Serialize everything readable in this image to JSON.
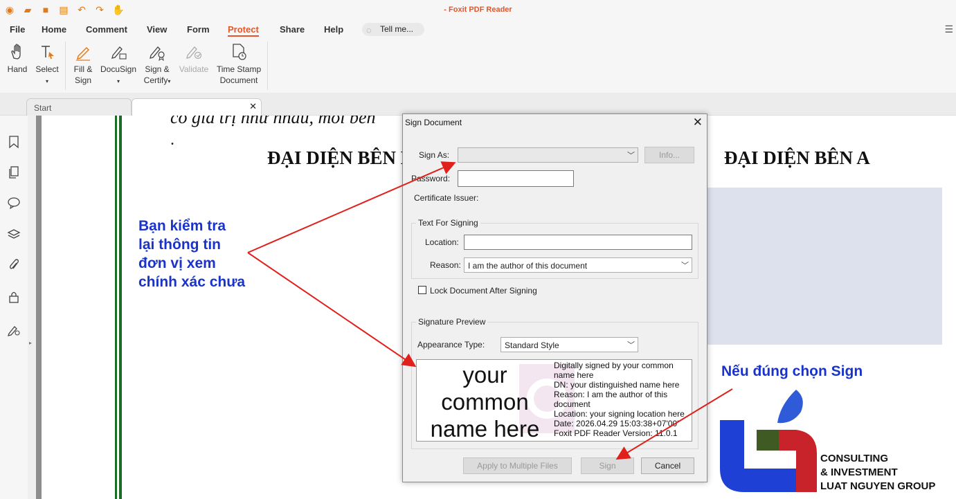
{
  "app": {
    "title": "- Foxit PDF Reader"
  },
  "menu": {
    "items": [
      "File",
      "Home",
      "Comment",
      "View",
      "Form",
      "Protect",
      "Share",
      "Help"
    ],
    "active": "Protect",
    "tell_me_placeholder": "Tell me..."
  },
  "ribbon": {
    "hand": "Hand",
    "select": "Select",
    "fill_sign": [
      "Fill &",
      "Sign"
    ],
    "docusign": "DocuSign",
    "sign_certify": [
      "Sign &",
      "Certify"
    ],
    "validate": "Validate",
    "timestamp": [
      "Time Stamp",
      "Document"
    ]
  },
  "tabs": {
    "start": "Start"
  },
  "document": {
    "text_line": "có giá trị như nhau, mỗi bên",
    "dot": ".",
    "heading_left": "ĐẠI DIỆN BÊN B",
    "heading_right": "ĐẠI DIỆN BÊN A"
  },
  "annotations": {
    "note1": [
      "Bạn kiểm tra",
      "lại thông tin",
      "đơn vị xem",
      "chính xác chưa"
    ],
    "note2": "Nếu đúng chọn Sign"
  },
  "logo": {
    "lines": [
      "CONSULTING",
      "& INVESTMENT",
      "LUAT NGUYEN GROUP"
    ]
  },
  "dialog": {
    "title": "Sign Document",
    "sign_as_label": "Sign As:",
    "info_button": "Info...",
    "password_label": "Password:",
    "cert_issuer_label": "Certificate Issuer:",
    "text_for_signing_title": "Text For Signing",
    "location_label": "Location:",
    "reason_label": "Reason:",
    "reason_value": "I am the author of this document",
    "lock_label": "Lock Document After Signing",
    "sig_preview_title": "Signature Preview",
    "appearance_label": "Appearance Type:",
    "appearance_value": "Standard Style",
    "preview_name": "your common name here",
    "preview_lines": [
      "Digitally signed by your common name here",
      "DN: your distinguished name here",
      "Reason: I am the author of this document",
      "Location: your signing location here",
      "Date: 2026.04.29 15:03:38+07'00'",
      "Foxit PDF Reader Version: 11.0.1"
    ],
    "apply_multiple": "Apply to Multiple Files",
    "sign_button": "Sign",
    "cancel_button": "Cancel"
  },
  "colors": {
    "accent": "#e2562a",
    "note": "#1a33c9",
    "arrow": "#e0201b"
  }
}
